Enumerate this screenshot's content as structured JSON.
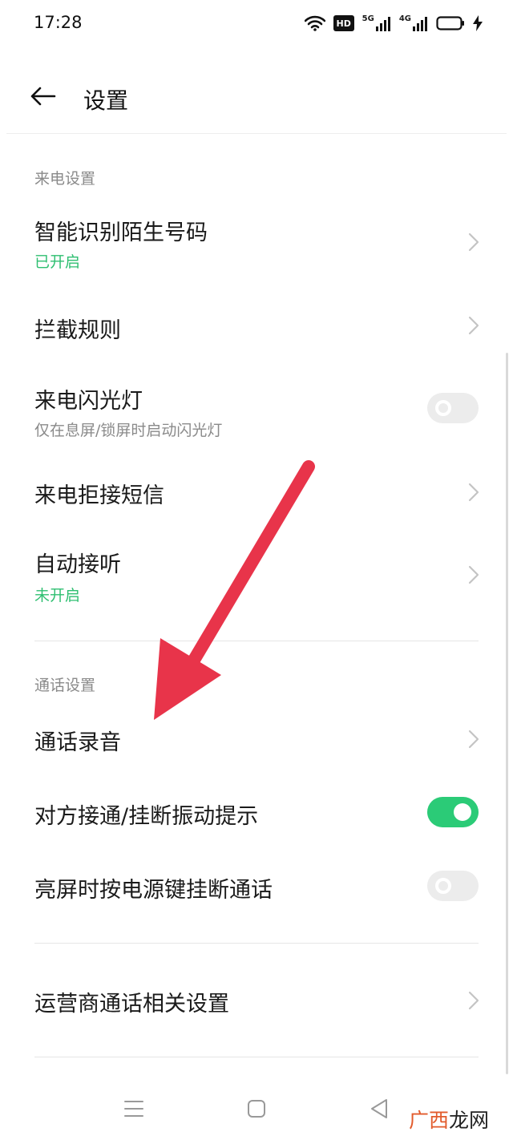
{
  "status_bar": {
    "time": "17:28",
    "icons": [
      "wifi-icon",
      "hd-icon",
      "signal-5g-icon",
      "signal-4g-icon",
      "battery-icon",
      "charging-bolt-icon"
    ],
    "hd_label": "HD",
    "net1_label": "5G",
    "net2_label": "4G"
  },
  "header": {
    "title": "设置",
    "back_icon": "back-arrow-icon"
  },
  "sections": {
    "incoming": {
      "title": "来电设置",
      "items": [
        {
          "title": "智能识别陌生号码",
          "subtitle": "已开启",
          "control": "chevron"
        },
        {
          "title": "拦截规则",
          "control": "chevron"
        },
        {
          "title": "来电闪光灯",
          "subtitle": "仅在息屏/锁屏时启动闪光灯",
          "control": "toggle",
          "state": "off"
        },
        {
          "title": "来电拒接短信",
          "control": "chevron"
        },
        {
          "title": "自动接听",
          "subtitle": "未开启",
          "control": "chevron"
        }
      ]
    },
    "call": {
      "title": "通话设置",
      "items": [
        {
          "title": "通话录音",
          "control": "chevron"
        },
        {
          "title": "对方接通/挂断振动提示",
          "control": "toggle",
          "state": "on"
        },
        {
          "title": "亮屏时按电源键挂断通话",
          "control": "toggle",
          "state": "off"
        }
      ]
    },
    "carrier": {
      "items": [
        {
          "title": "运营商通话相关设置",
          "control": "chevron"
        }
      ]
    }
  },
  "annotation": {
    "type": "red-arrow",
    "color": "#e8344a"
  },
  "nav_bar": {
    "icons": [
      "menu-icon",
      "home-square-icon",
      "back-triangle-icon"
    ]
  },
  "watermark": {
    "part1": "广西",
    "part2": "龙网"
  },
  "colors": {
    "accent_green": "#2bcb77",
    "subtitle_green": "#2fbf71",
    "section_gray": "#8a8a8a",
    "arrow_red": "#e8344a"
  }
}
